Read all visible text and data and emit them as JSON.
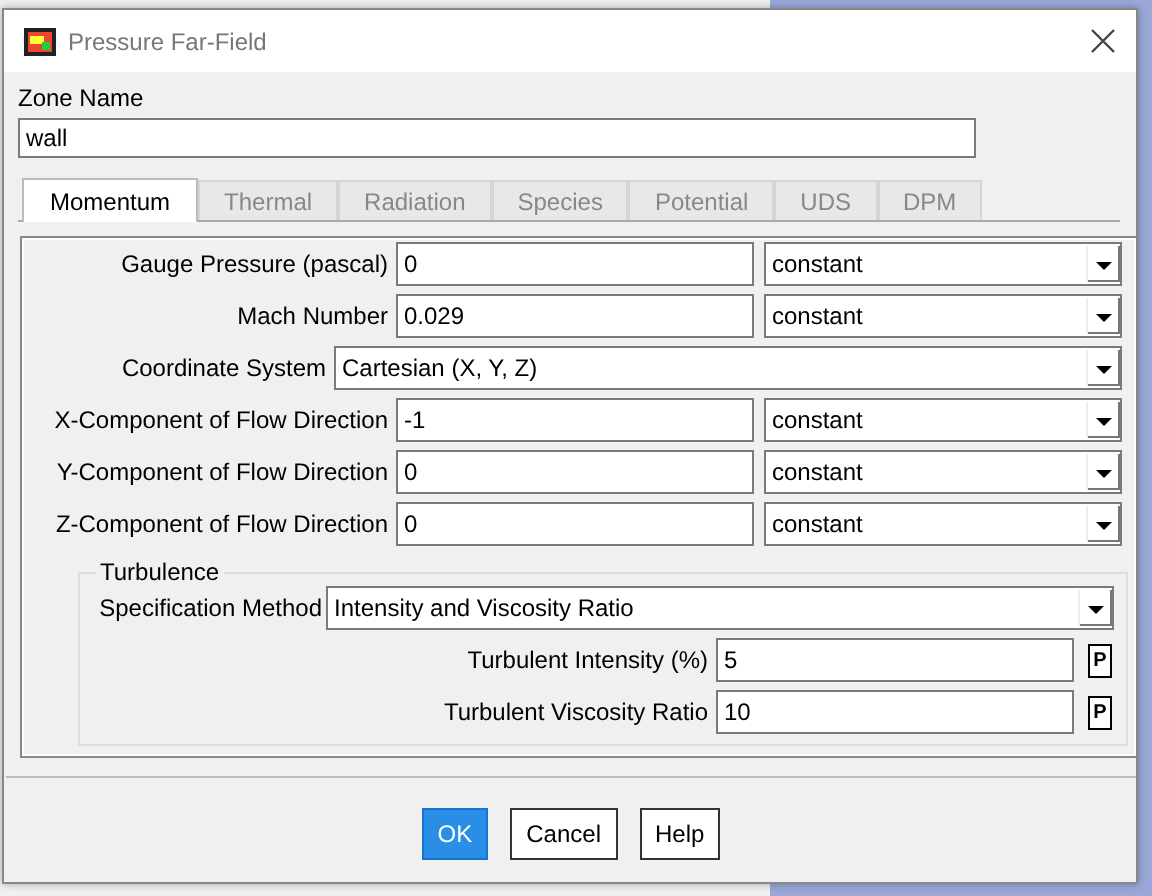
{
  "window": {
    "title": "Pressure Far-Field"
  },
  "zone": {
    "label": "Zone Name",
    "value": "wall"
  },
  "tabs": [
    {
      "label": "Momentum",
      "selected": true
    },
    {
      "label": "Thermal",
      "selected": false
    },
    {
      "label": "Radiation",
      "selected": false
    },
    {
      "label": "Species",
      "selected": false
    },
    {
      "label": "Potential",
      "selected": false
    },
    {
      "label": "UDS",
      "selected": false
    },
    {
      "label": "DPM",
      "selected": false
    }
  ],
  "fields": [
    {
      "kind": "value",
      "label": "Gauge Pressure (pascal)",
      "value": "0",
      "method": "constant"
    },
    {
      "kind": "value",
      "label": "Mach Number",
      "value": "0.029",
      "method": "constant"
    },
    {
      "kind": "select",
      "label": "Coordinate System",
      "value": "Cartesian (X, Y, Z)"
    },
    {
      "kind": "value",
      "label": "X-Component of Flow Direction",
      "value": "-1",
      "method": "constant"
    },
    {
      "kind": "value",
      "label": "Y-Component of Flow Direction",
      "value": "0",
      "method": "constant"
    },
    {
      "kind": "value",
      "label": "Z-Component of Flow Direction",
      "value": "0",
      "method": "constant"
    }
  ],
  "turbulence": {
    "title": "Turbulence",
    "method_label": "Specification Method",
    "method": "Intensity and Viscosity Ratio",
    "params": [
      {
        "label": "Turbulent Intensity (%)",
        "value": "5",
        "param_button": "P"
      },
      {
        "label": "Turbulent Viscosity Ratio",
        "value": "10",
        "param_button": "P"
      }
    ]
  },
  "buttons": [
    {
      "label": "OK",
      "default": true
    },
    {
      "label": "Cancel",
      "default": false
    },
    {
      "label": "Help",
      "default": false
    }
  ]
}
